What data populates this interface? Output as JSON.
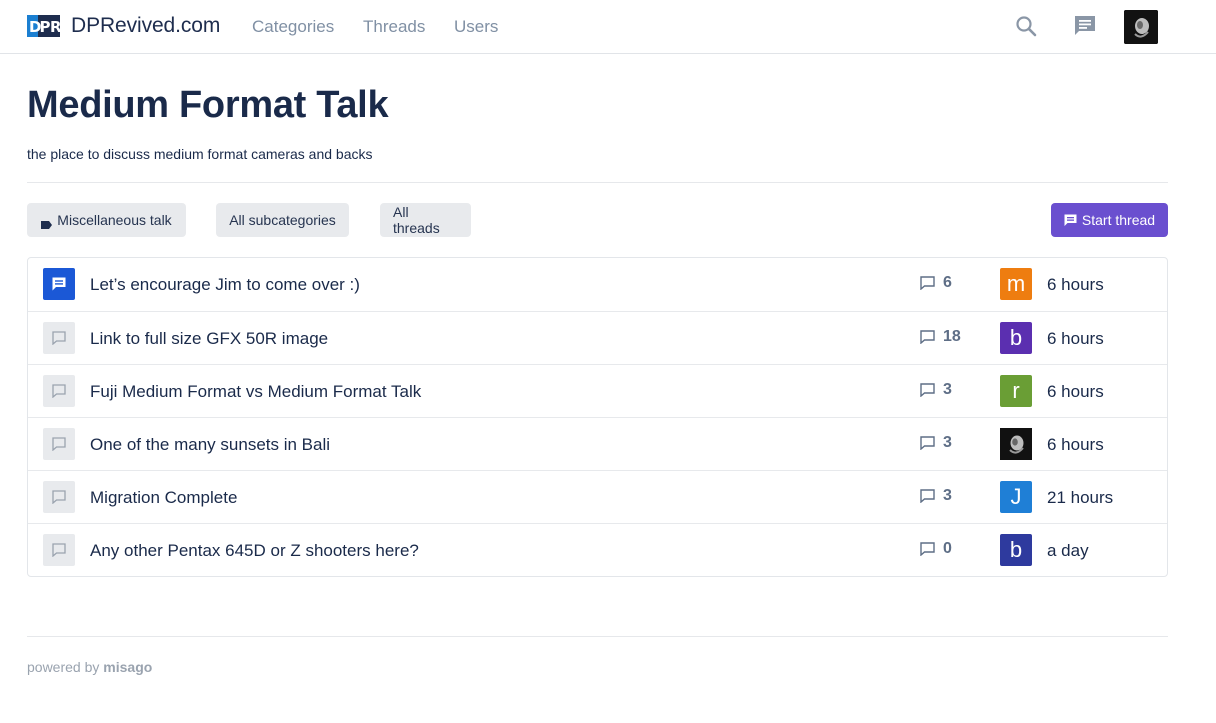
{
  "navbar": {
    "brand_logo_text": "DPR",
    "brand_name": "DPRevived.com",
    "links": [
      "Categories",
      "Threads",
      "Users"
    ]
  },
  "header": {
    "title": "Medium Format Talk",
    "description": "the place to discuss medium format cameras and backs"
  },
  "toolbar": {
    "subcategory_label": "Miscellaneous talk",
    "all_subcategories_label": "All subcategories",
    "all_threads_label": "All threads",
    "start_thread_label": "Start thread"
  },
  "threads": [
    {
      "title": "Let’s encourage Jim to come over :)",
      "replies": "6",
      "poster_initial": "m",
      "poster_color": "#ee7d10",
      "time": "6 hours",
      "unread": true
    },
    {
      "title": "Link to full size GFX 50R image",
      "replies": "18",
      "poster_initial": "b",
      "poster_color": "#5b2fb0",
      "time": "6 hours",
      "unread": false
    },
    {
      "title": "Fuji Medium Format vs Medium Format Talk",
      "replies": "3",
      "poster_initial": "r",
      "poster_color": "#6a9e35",
      "time": "6 hours",
      "unread": false
    },
    {
      "title": "One of the many sunsets in Bali",
      "replies": "3",
      "poster_initial": "",
      "poster_color": "#111111",
      "time": "6 hours",
      "unread": false
    },
    {
      "title": "Migration Complete",
      "replies": "3",
      "poster_initial": "J",
      "poster_color": "#1f7fd6",
      "time": "21 hours",
      "unread": false
    },
    {
      "title": "Any other Pentax 645D or Z shooters here?",
      "replies": "0",
      "poster_initial": "b",
      "poster_color": "#2e3a9e",
      "time": "a day",
      "unread": false
    }
  ],
  "footer": {
    "powered_by": "powered by",
    "engine": "misago"
  },
  "colors": {
    "accent": "#6a4fcf",
    "unread_icon": "#1b58d6",
    "title": "#1a2a4a"
  }
}
